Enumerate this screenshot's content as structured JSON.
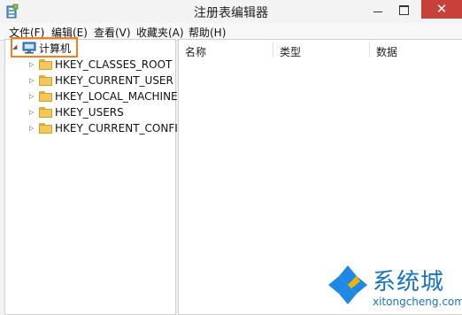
{
  "window": {
    "title": "注册表编辑器",
    "close_symbol": "✕"
  },
  "menu": {
    "items": [
      "文件(F)",
      "编辑(E)",
      "查看(V)",
      "收藏夹(A)",
      "帮助(H)"
    ]
  },
  "tree": {
    "root_label": "计算机",
    "root_expander": "◢",
    "child_expander": "▷",
    "children": [
      "HKEY_CLASSES_ROOT",
      "HKEY_CURRENT_USER",
      "HKEY_LOCAL_MACHINE",
      "HKEY_USERS",
      "HKEY_CURRENT_CONFIG"
    ]
  },
  "list": {
    "columns": [
      "名称",
      "类型",
      "数据"
    ]
  },
  "watermark": {
    "brand": "系统城",
    "url": "xitongcheng.com"
  },
  "icons": {
    "app": "registry-editor-icon",
    "computer": "computer-icon",
    "folder": "folder-icon"
  },
  "colors": {
    "highlight_border": "#f08020",
    "close_button": "#c8403a",
    "watermark_blue": "#1872c4"
  }
}
